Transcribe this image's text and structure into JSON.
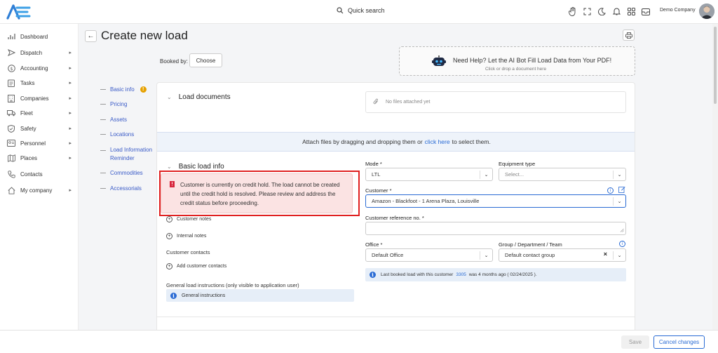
{
  "header": {
    "quick_search_label": "Quick search",
    "company_name": "Demo Company",
    "icons": [
      "hand-icon",
      "fullscreen-icon",
      "moon-icon",
      "bell-icon",
      "apps-grid-icon",
      "inbox-icon"
    ]
  },
  "sidebar": {
    "items": [
      {
        "label": "Dashboard",
        "icon": "dashboard-icon",
        "has_submenu": false
      },
      {
        "label": "Dispatch",
        "icon": "dispatch-icon",
        "has_submenu": true
      },
      {
        "label": "Accounting",
        "icon": "accounting-icon",
        "has_submenu": true
      },
      {
        "label": "Tasks",
        "icon": "tasks-icon",
        "has_submenu": true
      },
      {
        "label": "Companies",
        "icon": "companies-icon",
        "has_submenu": true
      },
      {
        "label": "Fleet",
        "icon": "fleet-icon",
        "has_submenu": true
      },
      {
        "label": "Safety",
        "icon": "safety-icon",
        "has_submenu": true
      },
      {
        "label": "Personnel",
        "icon": "personnel-icon",
        "has_submenu": true
      },
      {
        "label": "Places",
        "icon": "places-icon",
        "has_submenu": true
      },
      {
        "label": "Contacts",
        "icon": "contacts-icon",
        "has_submenu": false
      },
      {
        "label": "My company",
        "icon": "home-icon",
        "has_submenu": true
      }
    ],
    "chevron": "▸"
  },
  "page": {
    "title": "Create new load",
    "back_glyph": "←",
    "booked_by_label": "Booked by:",
    "choose_label": "Choose"
  },
  "ai_help": {
    "title": "Need Help? Let the AI Bot Fill Load Data from Your PDF!",
    "subtitle": "Click or drop a document here"
  },
  "steps": [
    {
      "label": "Basic info",
      "warning": "!"
    },
    {
      "label": "Pricing"
    },
    {
      "label": "Assets"
    },
    {
      "label": "Locations"
    },
    {
      "label": "Load Information Reminder"
    },
    {
      "label": "Commodities"
    },
    {
      "label": "Accessorials"
    }
  ],
  "load_documents": {
    "title": "Load documents",
    "empty_text": "No files attached yet",
    "drop_prefix": "Attach files by dragging and dropping them or",
    "drop_link": "click here",
    "drop_suffix": "to select them."
  },
  "basic_info": {
    "title": "Basic load info",
    "alert_text": "Customer is currently on credit hold. The load cannot be created until the credit hold is resolved. Please review and address the credit status before proceeding.",
    "customer_notes": "Customer notes",
    "internal_notes": "Internal notes",
    "customer_contacts_label": "Customer contacts",
    "add_contacts": "Add customer contacts",
    "instructions_label": "General load instructions (only visible to application user)",
    "instructions_button": "General instructions",
    "plus_glyph": "+",
    "info_glyph": "i"
  },
  "form": {
    "mode_label": "Mode *",
    "mode_value": "LTL",
    "equipment_label": "Equipment type",
    "equipment_placeholder": "Select...",
    "customer_label": "Customer *",
    "customer_value": "Amazon - Blackfoot - 1 Arena Plaza, Louisville",
    "customer_ref_label": "Customer reference no. *",
    "office_label": "Office *",
    "office_value": "Default Office",
    "group_label": "Group / Department / Team",
    "group_value": "Default contact group",
    "last_booked_prefix": "Last booked load with this customer",
    "last_booked_number": "3305",
    "last_booked_suffix": "was 4 months ago ( 02/24/2025 ).",
    "caret": "⌄",
    "clear": "×"
  },
  "footer": {
    "save_label": "Save",
    "cancel_label": "Cancel changes"
  },
  "colors": {
    "accent": "#2a6bd4",
    "alert_bg": "#fbe3e3",
    "alert_outline": "#e02020",
    "warning": "#e6a100"
  }
}
